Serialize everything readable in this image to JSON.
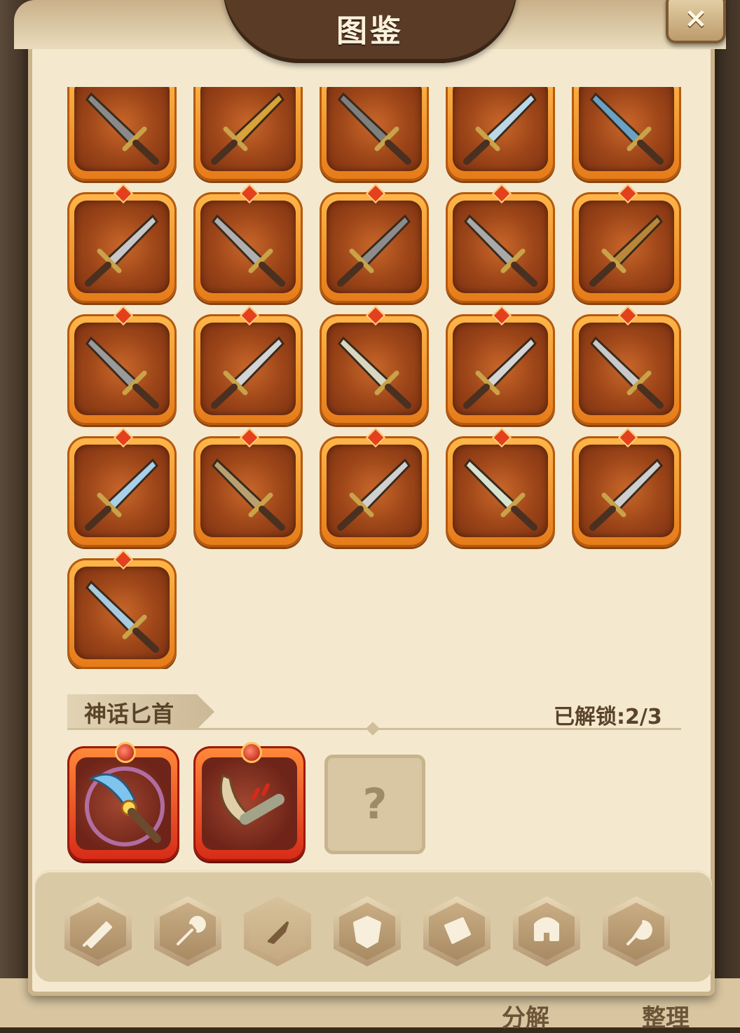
{
  "window": {
    "title": "图鉴"
  },
  "close_label": "×",
  "collection": {
    "rows": 5,
    "items": [
      {
        "name": "dagger-item-1",
        "color": "#8a8a8a"
      },
      {
        "name": "dagger-item-2",
        "color": "#d9a23a"
      },
      {
        "name": "dagger-item-3",
        "color": "#7f7f7f"
      },
      {
        "name": "dagger-item-4",
        "color": "#bcd8e8"
      },
      {
        "name": "dagger-item-5",
        "color": "#6aa2c6"
      },
      {
        "name": "dagger-item-6",
        "color": "#c8c8c8"
      },
      {
        "name": "dagger-item-7",
        "color": "#b0b0b0"
      },
      {
        "name": "dagger-item-8",
        "color": "#8c8c8c"
      },
      {
        "name": "dagger-item-9",
        "color": "#a9a9a9"
      },
      {
        "name": "dagger-item-10",
        "color": "#b9873a"
      },
      {
        "name": "dagger-item-11",
        "color": "#9a9a9a"
      },
      {
        "name": "dagger-item-12",
        "color": "#d4d4d4"
      },
      {
        "name": "dagger-item-13",
        "color": "#d8d8c0"
      },
      {
        "name": "dagger-item-14",
        "color": "#d6d6d6"
      },
      {
        "name": "dagger-item-15",
        "color": "#c9c9c9"
      },
      {
        "name": "dagger-item-16",
        "color": "#a8d0ea"
      },
      {
        "name": "dagger-item-17",
        "color": "#b8a070"
      },
      {
        "name": "dagger-item-18",
        "color": "#d0d0d0"
      },
      {
        "name": "dagger-item-19",
        "color": "#d9e4d0"
      },
      {
        "name": "dagger-item-20",
        "color": "#cfcfcf"
      },
      {
        "name": "dagger-item-21",
        "color": "#a9cbe0"
      }
    ]
  },
  "mythic": {
    "title": "神话匕首",
    "unlocked_label": "已解锁:2/3",
    "locked_symbol": "?",
    "items": [
      {
        "name": "mythic-dagger-1",
        "color": "#7fc4ee"
      },
      {
        "name": "mythic-dagger-2",
        "color": "#e0cfa8"
      }
    ]
  },
  "tabs": [
    {
      "name": "tab-sword",
      "icon": "sword-icon",
      "active": false
    },
    {
      "name": "tab-club",
      "icon": "club-icon",
      "active": false
    },
    {
      "name": "tab-dagger",
      "icon": "dagger-icon",
      "active": true
    },
    {
      "name": "tab-shield",
      "icon": "shield-icon",
      "active": false
    },
    {
      "name": "tab-book",
      "icon": "book-icon",
      "active": false
    },
    {
      "name": "tab-helmet",
      "icon": "helmet-icon",
      "active": false
    },
    {
      "name": "tab-amulet",
      "icon": "amulet-icon",
      "active": false
    }
  ],
  "background": {
    "left_text": "分解",
    "right_text": "整理"
  }
}
